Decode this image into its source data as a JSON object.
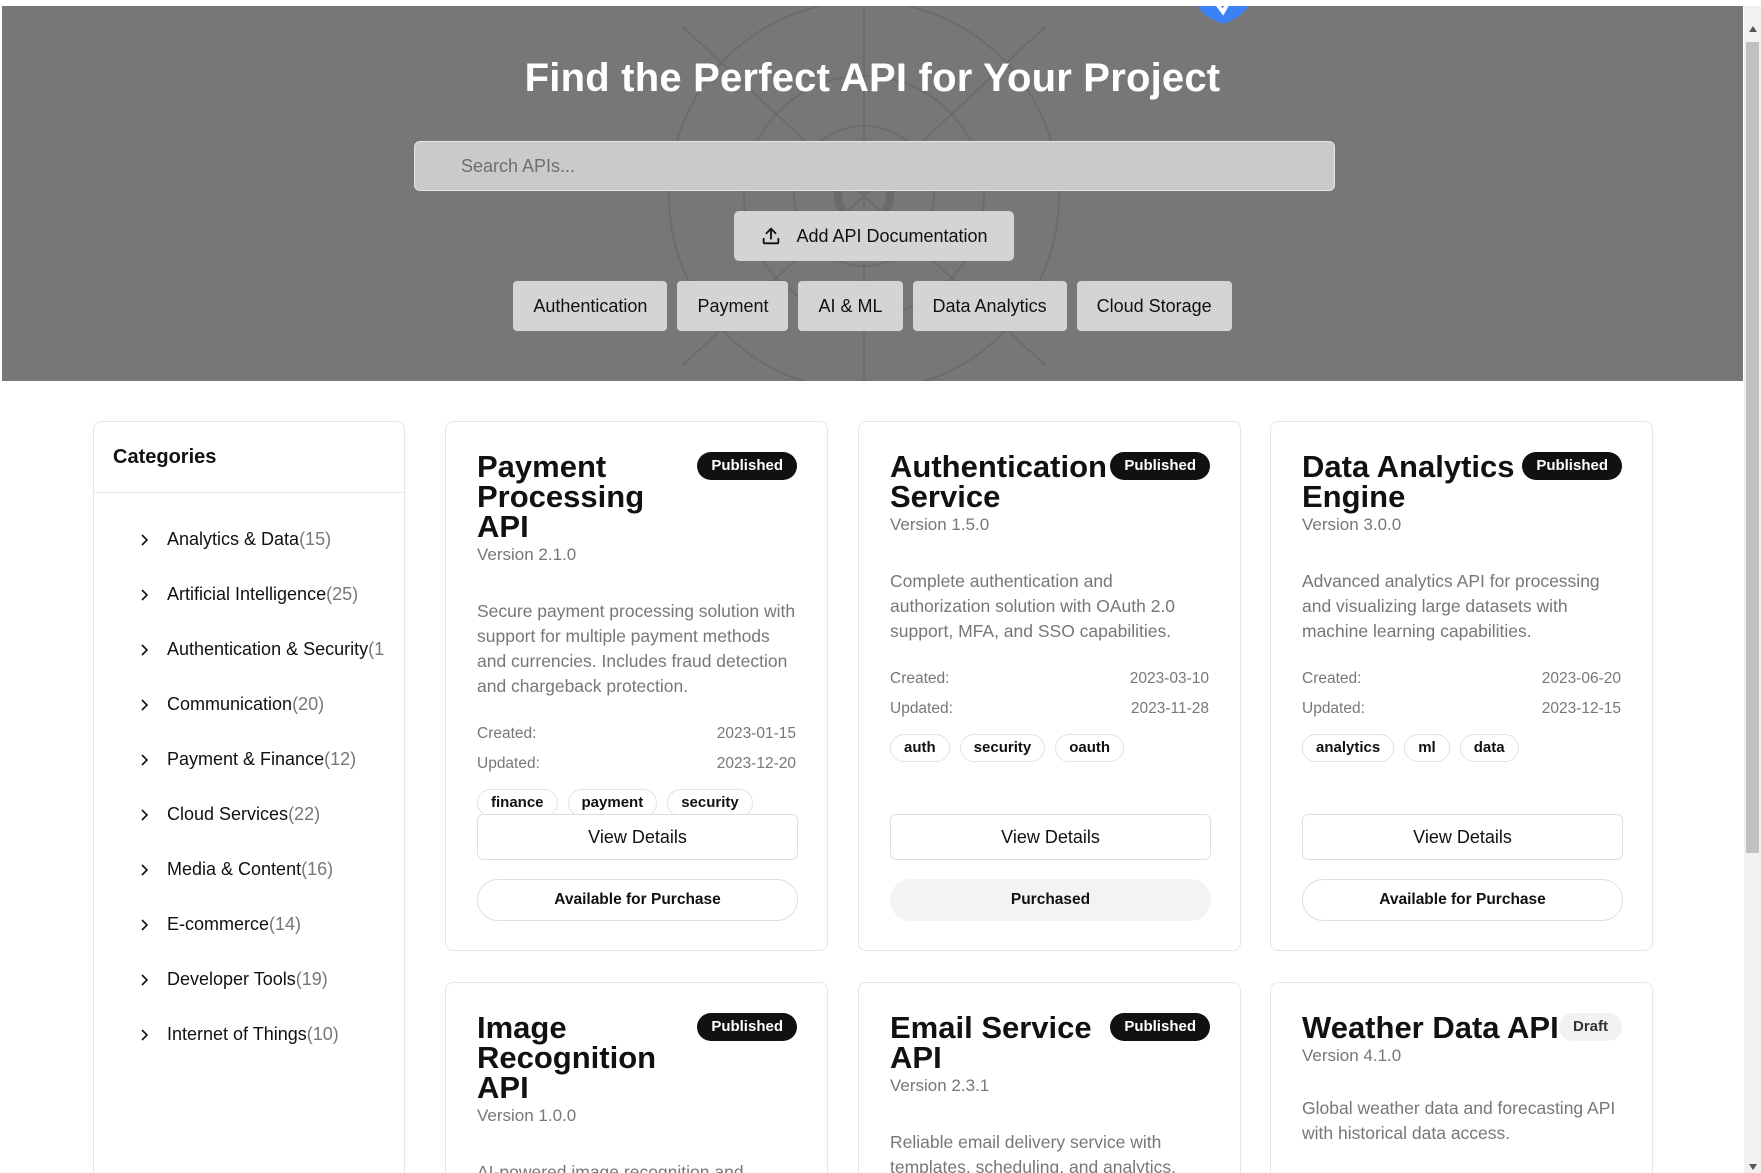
{
  "hero": {
    "title": "Find the Perfect API for Your Project",
    "search_placeholder": "Search APIs...",
    "add_button_label": "Add API Documentation",
    "quick_filters": [
      "Authentication",
      "Payment",
      "AI & ML",
      "Data Analytics",
      "Cloud Storage"
    ]
  },
  "sidebar": {
    "title": "Categories",
    "items": [
      {
        "label": "Analytics & Data",
        "count": "(15)"
      },
      {
        "label": "Artificial Intelligence",
        "count": "(25)"
      },
      {
        "label": "Authentication & Security",
        "count": "(1"
      },
      {
        "label": "Communication",
        "count": "(20)"
      },
      {
        "label": "Payment & Finance",
        "count": "(12)"
      },
      {
        "label": "Cloud Services",
        "count": "(22)"
      },
      {
        "label": "Media & Content",
        "count": "(16)"
      },
      {
        "label": "E-commerce",
        "count": "(14)"
      },
      {
        "label": "Developer Tools",
        "count": "(19)"
      },
      {
        "label": "Internet of Things",
        "count": "(10)"
      }
    ]
  },
  "cards": [
    {
      "title": "Payment Processing API",
      "status": "Published",
      "version": "Version 2.1.0",
      "description": "Secure payment processing solution with support for multiple payment methods and currencies. Includes fraud detection and chargeback protection.",
      "created_label": "Created:",
      "created": "2023-01-15",
      "updated_label": "Updated:",
      "updated": "2023-12-20",
      "tags": [
        "finance",
        "payment",
        "security"
      ],
      "view_label": "View Details",
      "purchase_label": "Available for Purchase"
    },
    {
      "title": "Authentication Service",
      "status": "Published",
      "version": "Version 1.5.0",
      "description": "Complete authentication and authorization solution with OAuth 2.0 support, MFA, and SSO capabilities.",
      "created_label": "Created:",
      "created": "2023-03-10",
      "updated_label": "Updated:",
      "updated": "2023-11-28",
      "tags": [
        "auth",
        "security",
        "oauth"
      ],
      "view_label": "View Details",
      "purchase_label": "Purchased"
    },
    {
      "title": "Data Analytics Engine",
      "status": "Published",
      "version": "Version 3.0.0",
      "description": "Advanced analytics API for processing and visualizing large datasets with machine learning capabilities.",
      "created_label": "Created:",
      "created": "2023-06-20",
      "updated_label": "Updated:",
      "updated": "2023-12-15",
      "tags": [
        "analytics",
        "ml",
        "data"
      ],
      "view_label": "View Details",
      "purchase_label": "Available for Purchase"
    },
    {
      "title": "Image Recognition API",
      "status": "Published",
      "version": "Version 1.0.0",
      "description": "AI-powered image recognition and classification service with support for"
    },
    {
      "title": "Email Service API",
      "status": "Published",
      "version": "Version 2.3.1",
      "description": "Reliable email delivery service with templates, scheduling, and analytics."
    },
    {
      "title": "Weather Data API",
      "status": "Draft",
      "version": "Version 4.1.0",
      "description": "Global weather data and forecasting API with historical data access."
    }
  ],
  "colors": {
    "hero_bg": "#777777",
    "badge_published": "#111111",
    "badge_draft": "#f1f1f1"
  }
}
